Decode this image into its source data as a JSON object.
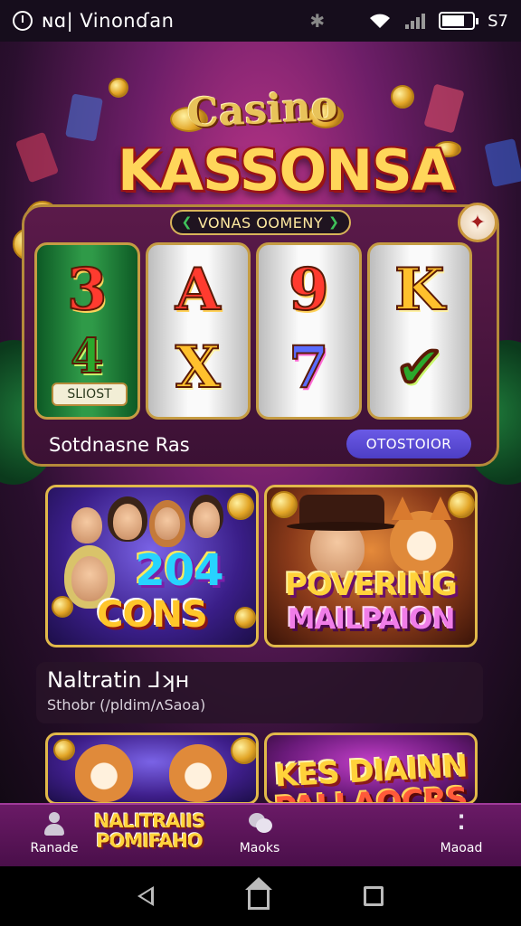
{
  "status_bar": {
    "app_title": "ɴɑ| Vinonɗan",
    "battery_text": "S7"
  },
  "logo": {
    "line1": "Casino",
    "line2": "KASSONSA"
  },
  "slot_machine": {
    "banner": "VONAS OOMENY",
    "reels": [
      {
        "top": "3",
        "bottom": "4",
        "label": "SLIOST"
      },
      {
        "top": "A",
        "bottom": "X"
      },
      {
        "top": "9",
        "bottom": "7"
      },
      {
        "top": "K",
        "bottom": "✔"
      }
    ],
    "footer_label": "Sotdnasne Ras",
    "footer_button": "OTOSTOIOR"
  },
  "games": [
    {
      "title_line1": "204",
      "title_line2": "CONS"
    },
    {
      "title_line1": "POVERING",
      "title_line2": "MAILPAION"
    },
    {
      "title_line1": "KES DIAINN",
      "title_line2": "PALLAOCRS"
    }
  ],
  "section": {
    "title": "Naltratin ⅃ʞʜ",
    "subtitle": "Sthobr (/pldim/ʌSaoa)"
  },
  "bottom_nav": {
    "items": [
      {
        "label": "Ranade",
        "icon": "person-icon"
      },
      {
        "label": "Maoks",
        "icon": "chat-icon"
      },
      {
        "label": "Maoad",
        "icon": "more-icon"
      }
    ],
    "promo_line1": "NALITRAIIS",
    "promo_line2": "POMIFAHO"
  },
  "colors": {
    "accent_gold": "#e1b94a",
    "nav_purple": "#6a1a66",
    "button_violet": "#5a4ad8",
    "reel_green": "#2f9a48"
  }
}
